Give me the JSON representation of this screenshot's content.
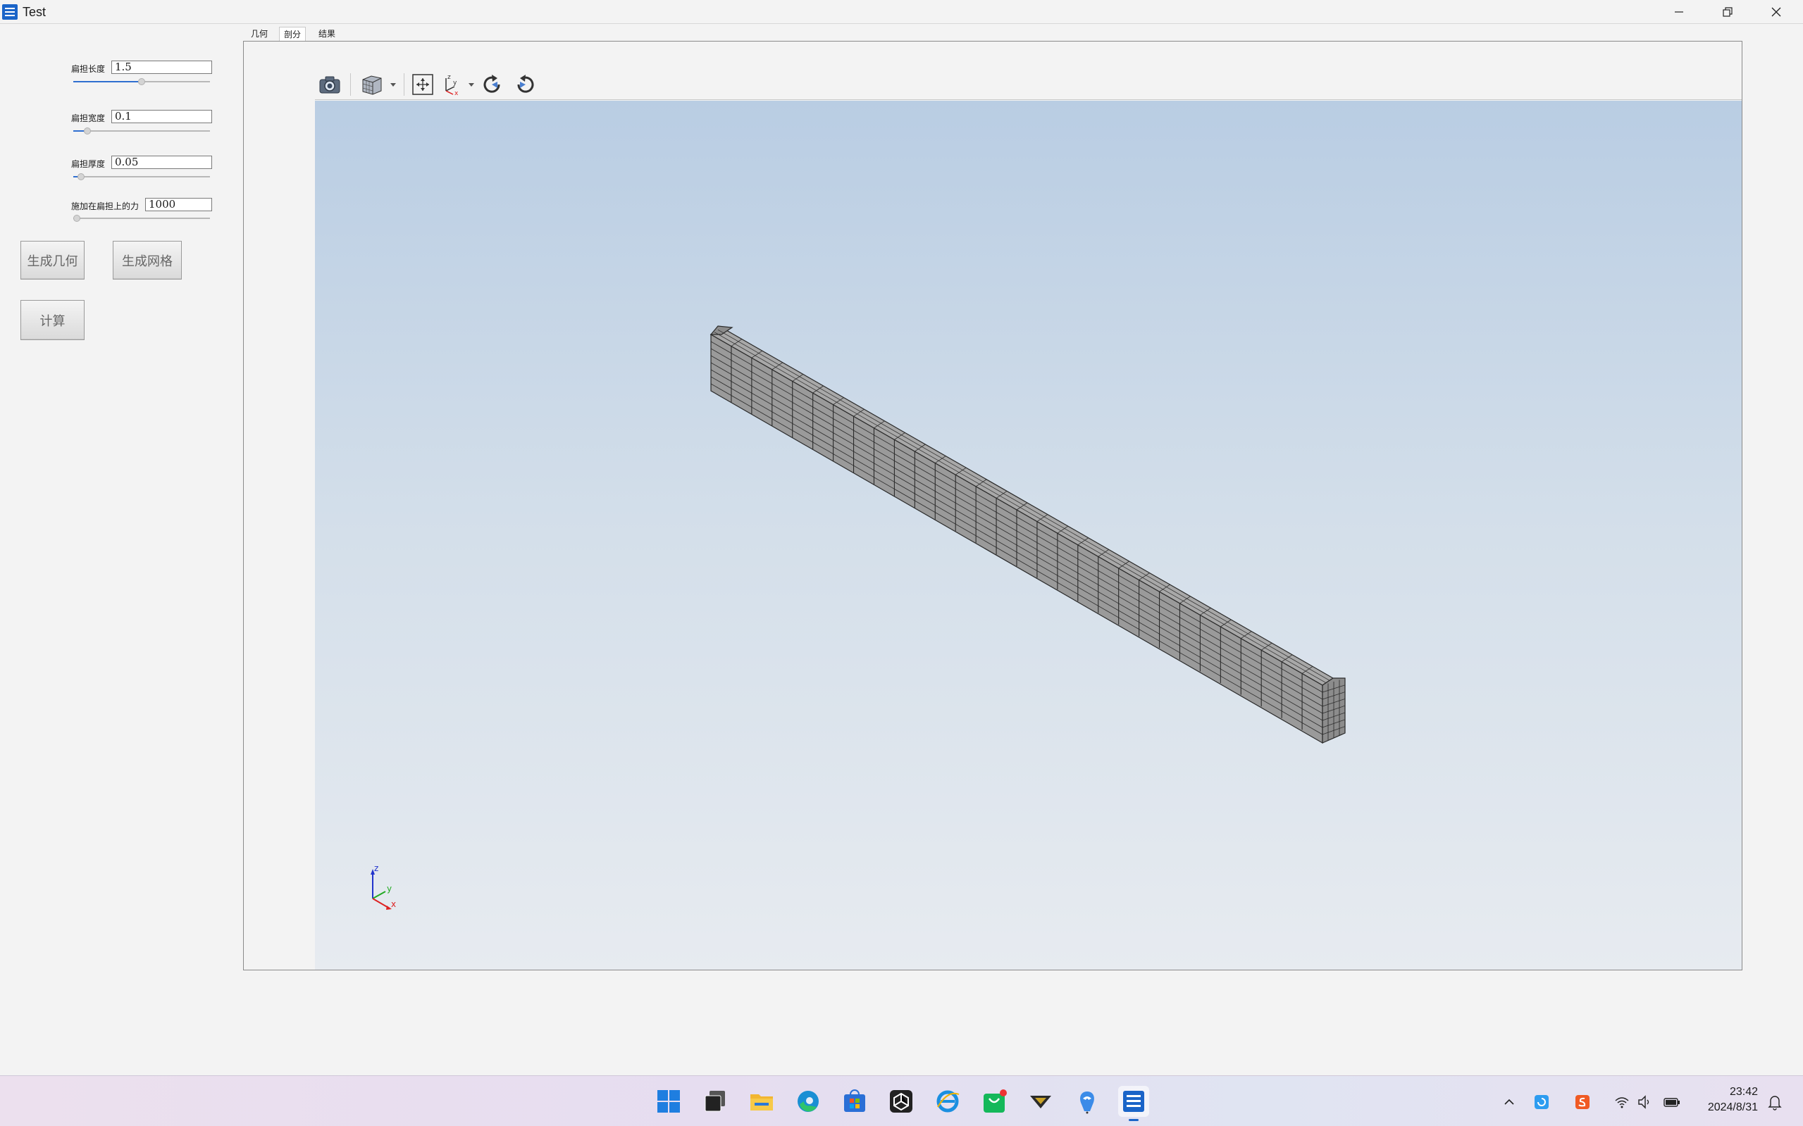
{
  "window": {
    "title": "Test"
  },
  "params": [
    {
      "label": "扁担长度",
      "value": "1.5",
      "slider": 0.5
    },
    {
      "label": "扁担宽度",
      "value": "0.1",
      "slider": 0.08
    },
    {
      "label": "扁担厚度",
      "value": "0.05",
      "slider": 0.03
    },
    {
      "label": "施加在扁担上的力",
      "value": "1000",
      "slider": 0.0
    }
  ],
  "buttons": {
    "geometry": "生成几何",
    "mesh": "生成网格",
    "compute": "计算"
  },
  "tabs": [
    {
      "label": "几何",
      "active": false
    },
    {
      "label": "剖分",
      "active": true
    },
    {
      "label": "结果",
      "active": false
    }
  ],
  "toolbar": {
    "icons": [
      "camera-icon",
      "view-cube-icon",
      "fit-all-icon",
      "axis-view-icon",
      "rotate-cw-icon",
      "rotate-ccw-icon"
    ]
  },
  "viewport": {
    "background_top": "#b9cde3",
    "background_bottom": "#e7ebf0",
    "mesh_color": "#9a9a9a",
    "triad": {
      "x": "x",
      "y": "y",
      "z": "z"
    }
  },
  "taskbar": {
    "apps": [
      "windows-start-icon",
      "task-view-icon",
      "file-explorer-icon",
      "edge-icon",
      "store-icon",
      "unity-icon",
      "ie-icon",
      "wechat-store-icon",
      "game-icon",
      "qq-icon",
      "test-app-icon"
    ],
    "time": "23:42",
    "date": "2024/8/31"
  }
}
